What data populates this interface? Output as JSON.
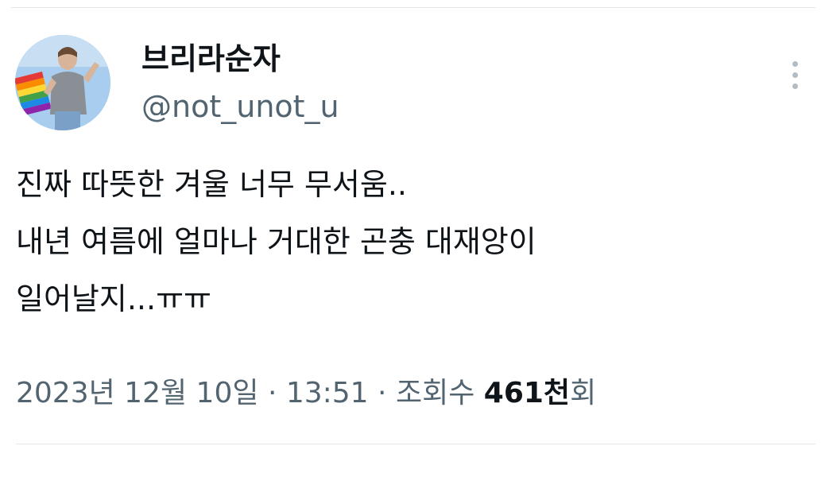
{
  "author": {
    "display_name": "브리라순자",
    "handle": "@not_unot_u"
  },
  "tweet": {
    "lines": [
      "진짜 따뜻한 겨울 너무 무서움..",
      "내년 여름에 얼마나 거대한 곤충 대재앙이",
      "일어날지...ㅠㅠ"
    ]
  },
  "meta": {
    "date": "2023년 12월 10일",
    "separator": "·",
    "time": "13:51",
    "views_label": "조회수",
    "views_count": "461천",
    "views_suffix": "회"
  },
  "icons": {
    "more": "more-vertical-icon"
  }
}
